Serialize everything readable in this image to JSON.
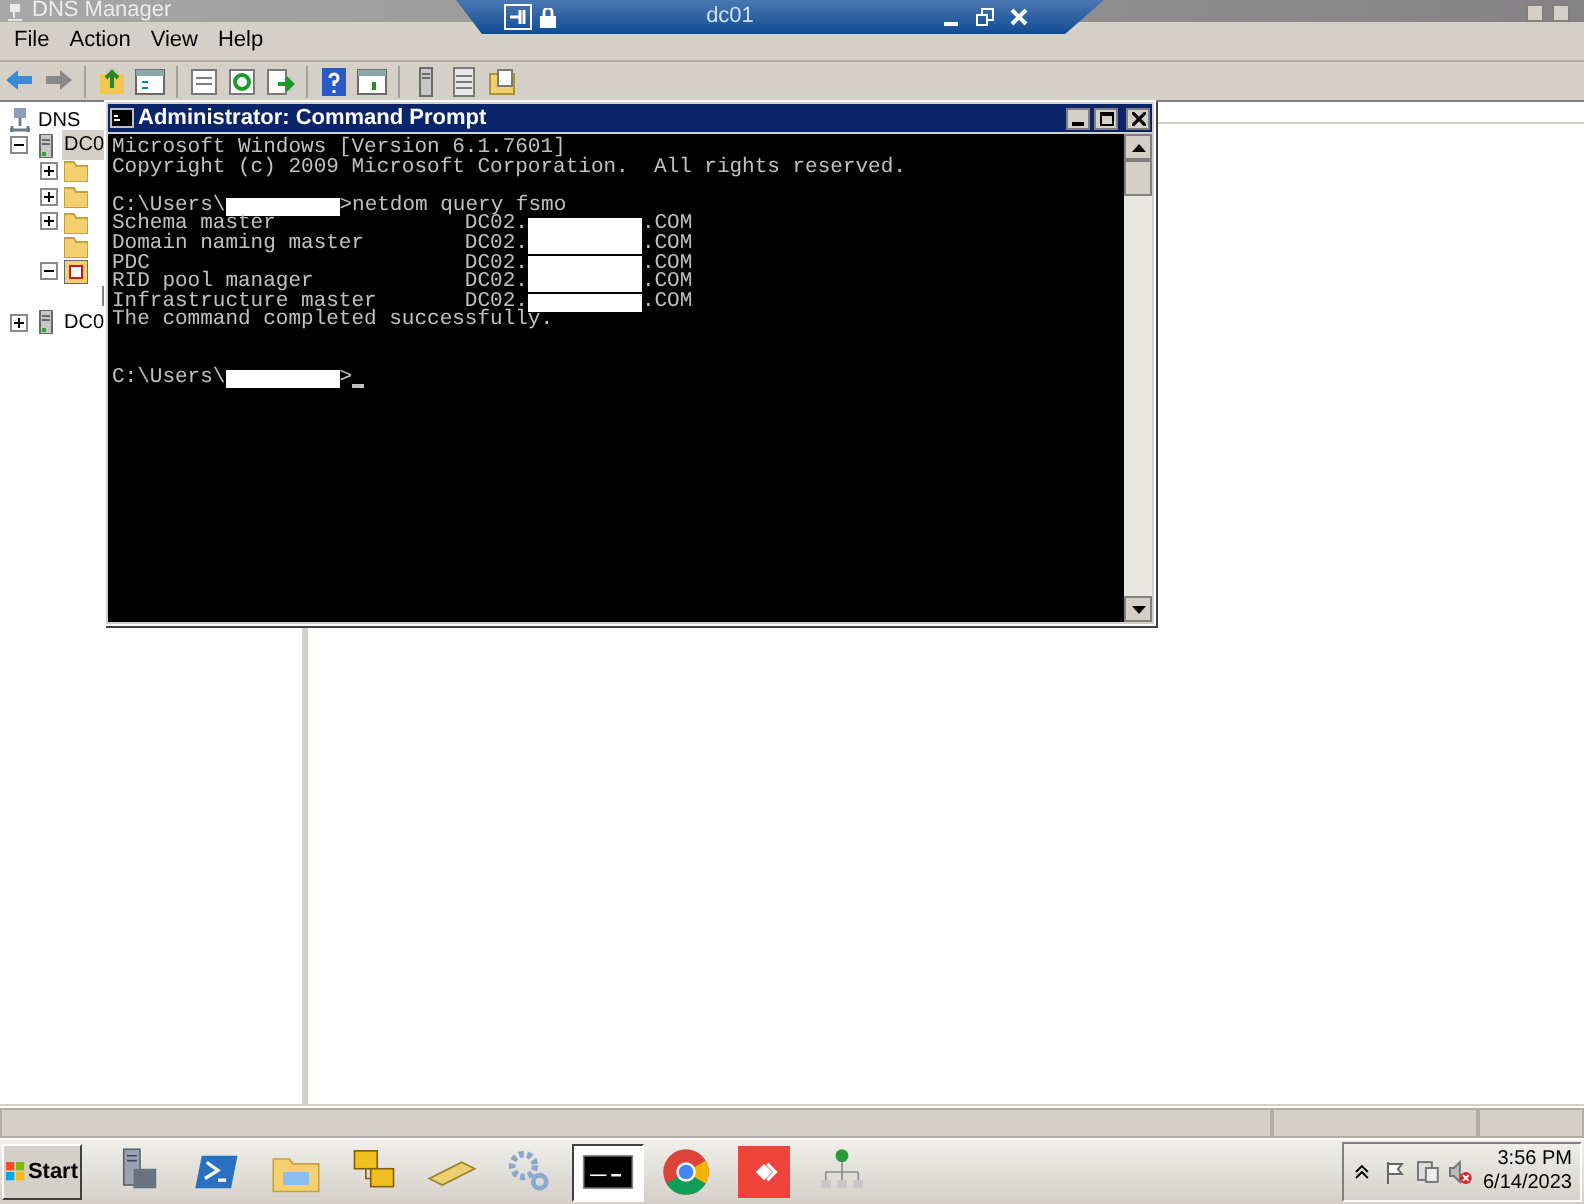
{
  "window": {
    "title": "DNS Manager"
  },
  "remote_bar": {
    "title": "dc01"
  },
  "menu": [
    "File",
    "Action",
    "View",
    "Help"
  ],
  "tree": [
    {
      "label": "DNS",
      "selected": false,
      "kind": "dns",
      "children": [
        {
          "label": "DC0",
          "expanded": true,
          "selected": true,
          "kind": "server",
          "children": [
            {
              "expanded": false,
              "kind": "folder"
            },
            {
              "expanded": false,
              "kind": "folder"
            },
            {
              "expanded": false,
              "kind": "folder"
            },
            {
              "kind": "folder"
            },
            {
              "expanded": true,
              "kind": "log",
              "children": [
                {
                  "kind": "record"
                }
              ]
            }
          ]
        },
        {
          "label": "DC0",
          "expanded": false,
          "selected": false,
          "kind": "server"
        }
      ]
    }
  ],
  "console": {
    "title": "Administrator: Command Prompt",
    "lines": [
      {
        "kind": "text",
        "parts": [
          {
            "kind": "text",
            "text": "Microsoft Windows [Version 6.1.7601]"
          }
        ]
      },
      {
        "kind": "text",
        "parts": [
          {
            "kind": "text",
            "text": "Copyright (c) 2009 Microsoft Corporation.  All rights reserved."
          }
        ]
      },
      {
        "kind": "blank"
      },
      {
        "kind": "text",
        "parts": [
          {
            "kind": "text",
            "text": "C:\\Users\\"
          },
          {
            "kind": "redacted"
          },
          {
            "kind": "text",
            "text": ">netdom query fsmo"
          }
        ]
      },
      {
        "kind": "text",
        "parts": [
          {
            "kind": "text",
            "text": "Schema master               DC02."
          },
          {
            "kind": "redacted"
          },
          {
            "kind": "text",
            "text": ".COM"
          }
        ]
      },
      {
        "kind": "text",
        "parts": [
          {
            "kind": "text",
            "text": "Domain naming master        DC02."
          },
          {
            "kind": "redacted"
          },
          {
            "kind": "text",
            "text": ".COM"
          }
        ]
      },
      {
        "kind": "text",
        "parts": [
          {
            "kind": "text",
            "text": "PDC                         DC02."
          },
          {
            "kind": "redacted"
          },
          {
            "kind": "text",
            "text": ".COM"
          }
        ]
      },
      {
        "kind": "text",
        "parts": [
          {
            "kind": "text",
            "text": "RID pool manager            DC02."
          },
          {
            "kind": "redacted"
          },
          {
            "kind": "text",
            "text": ".COM"
          }
        ]
      },
      {
        "kind": "text",
        "parts": [
          {
            "kind": "text",
            "text": "Infrastructure master       DC02."
          },
          {
            "kind": "redacted"
          },
          {
            "kind": "text",
            "text": ".COM"
          }
        ]
      },
      {
        "kind": "text",
        "parts": [
          {
            "kind": "text",
            "text": "The command completed successfully."
          }
        ]
      },
      {
        "kind": "blank"
      },
      {
        "kind": "blank"
      },
      {
        "kind": "text",
        "parts": [
          {
            "kind": "text",
            "text": "C:\\Users\\"
          },
          {
            "kind": "redacted"
          },
          {
            "kind": "text",
            "text": ">"
          },
          {
            "kind": "cursor"
          }
        ]
      }
    ]
  },
  "taskbar": {
    "start": "Start",
    "items": [
      {
        "kind": "server-manager",
        "selected": false
      },
      {
        "kind": "powershell",
        "selected": false
      },
      {
        "kind": "explorer",
        "selected": false
      },
      {
        "kind": "network",
        "selected": false
      },
      {
        "kind": "ruler",
        "selected": false
      },
      {
        "kind": "gears",
        "selected": false
      },
      {
        "kind": "cmd",
        "selected": true
      },
      {
        "kind": "chrome",
        "selected": false
      },
      {
        "kind": "anydesk",
        "selected": false
      },
      {
        "kind": "topology",
        "selected": false
      }
    ],
    "time": "3:56 PM",
    "date": "6/14/2023"
  }
}
